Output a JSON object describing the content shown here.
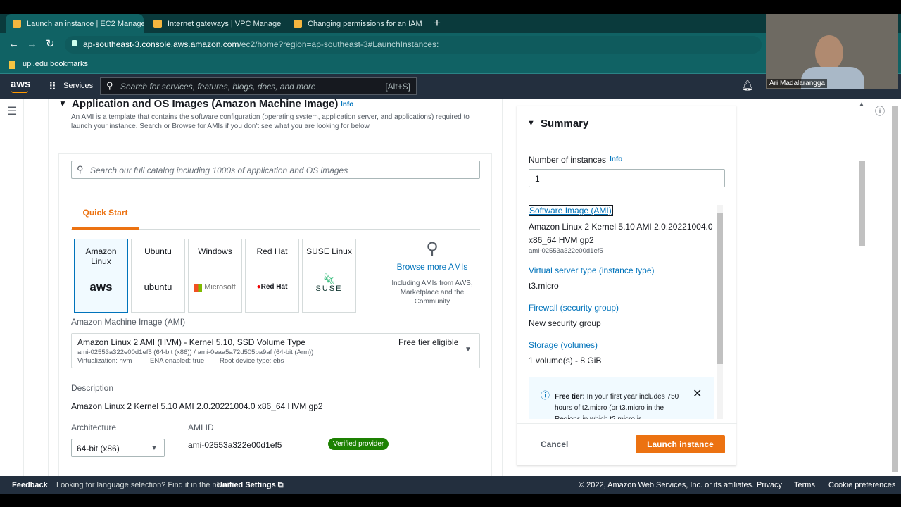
{
  "browser": {
    "tabs": [
      {
        "title": "Launch an instance | EC2 Manage",
        "active": true
      },
      {
        "title": "Internet gateways | VPC Manage",
        "active": false
      },
      {
        "title": "Changing permissions for an IAM",
        "active": false
      }
    ],
    "new_tab": "+",
    "url_host": "ap-southeast-3.console.aws.amazon.com",
    "url_path": "/ec2/home?region=ap-southeast-3#LaunchInstances:",
    "bookmark": "upi.edu bookmarks"
  },
  "webcam": {
    "name": "Ari Madalarangga"
  },
  "awsnav": {
    "logo": "aws",
    "services": "Services",
    "search_placeholder": "Search for services, features, blogs, docs, and more",
    "shortcut": "[Alt+S]"
  },
  "ami_section": {
    "title": "Application and OS Images (Amazon Machine Image)",
    "info": "Info",
    "description": "An AMI is a template that contains the software configuration (operating system, application server, and applications) required to launch your instance. Search or Browse for AMIs if you don't see what you are looking for below",
    "search_placeholder": "Search our full catalog including 1000s of application and OS images",
    "tab": "Quick Start",
    "os_cards": [
      {
        "name": "Amazon Linux",
        "logo": "aws"
      },
      {
        "name": "Ubuntu",
        "logo": "ubuntu"
      },
      {
        "name": "Windows",
        "logo": "Microsoft"
      },
      {
        "name": "Red Hat",
        "logo": "Red Hat"
      },
      {
        "name": "SUSE Linux",
        "logo": "SUSE"
      }
    ],
    "browse_more": "Browse more AMIs",
    "browse_sub": "Including AMIs from AWS, Marketplace and the Community",
    "ami_label": "Amazon Machine Image (AMI)",
    "ami_select": {
      "name": "Amazon Linux 2 AMI (HVM) - Kernel 5.10, SSD Volume Type",
      "ids": "ami-02553a322e00d1ef5 (64-bit (x86)) / ami-0eaa5a72d505ba9af (64-bit (Arm))",
      "virt": "Virtualization: hvm",
      "ena": "ENA enabled: true",
      "root": "Root device type: ebs",
      "badge": "Free tier eligible"
    },
    "description_label": "Description",
    "description_value": "Amazon Linux 2 Kernel 5.10 AMI 2.0.20221004.0 x86_64 HVM gp2",
    "arch_label": "Architecture",
    "arch_value": "64-bit (x86)",
    "ami_id_label": "AMI ID",
    "ami_id_value": "ami-02553a322e00d1ef5",
    "verified": "Verified provider"
  },
  "summary": {
    "title": "Summary",
    "instances_label": "Number of instances",
    "info": "Info",
    "instances_value": "1",
    "ami_h": "Software Image (AMI)",
    "ami_v": "Amazon Linux 2 Kernel 5.10 AMI 2.0.20221004.0 x86_64 HVM gp2",
    "ami_id": "ami-02553a322e00d1ef5",
    "type_h": "Virtual server type (instance type)",
    "type_v": "t3.micro",
    "fw_h": "Firewall (security group)",
    "fw_v": "New security group",
    "storage_h": "Storage (volumes)",
    "storage_v": "1 volume(s) - 8 GiB",
    "free_tier_bold": "Free tier:",
    "free_tier_text": "In your first year includes 750 hours of t2.micro (or t3.micro in the Regions in which t2.micro is",
    "cancel": "Cancel",
    "launch": "Launch instance"
  },
  "footer": {
    "feedback": "Feedback",
    "lang": "Looking for language selection? Find it in the new",
    "unified": "Unified Settings",
    "copyright": "© 2022, Amazon Web Services, Inc. or its affiliates.",
    "privacy": "Privacy",
    "terms": "Terms",
    "cookies": "Cookie preferences"
  },
  "colors": {
    "accent": "#ec7211",
    "link": "#0073bb",
    "nav": "#232f3e",
    "browser": "#106264"
  }
}
